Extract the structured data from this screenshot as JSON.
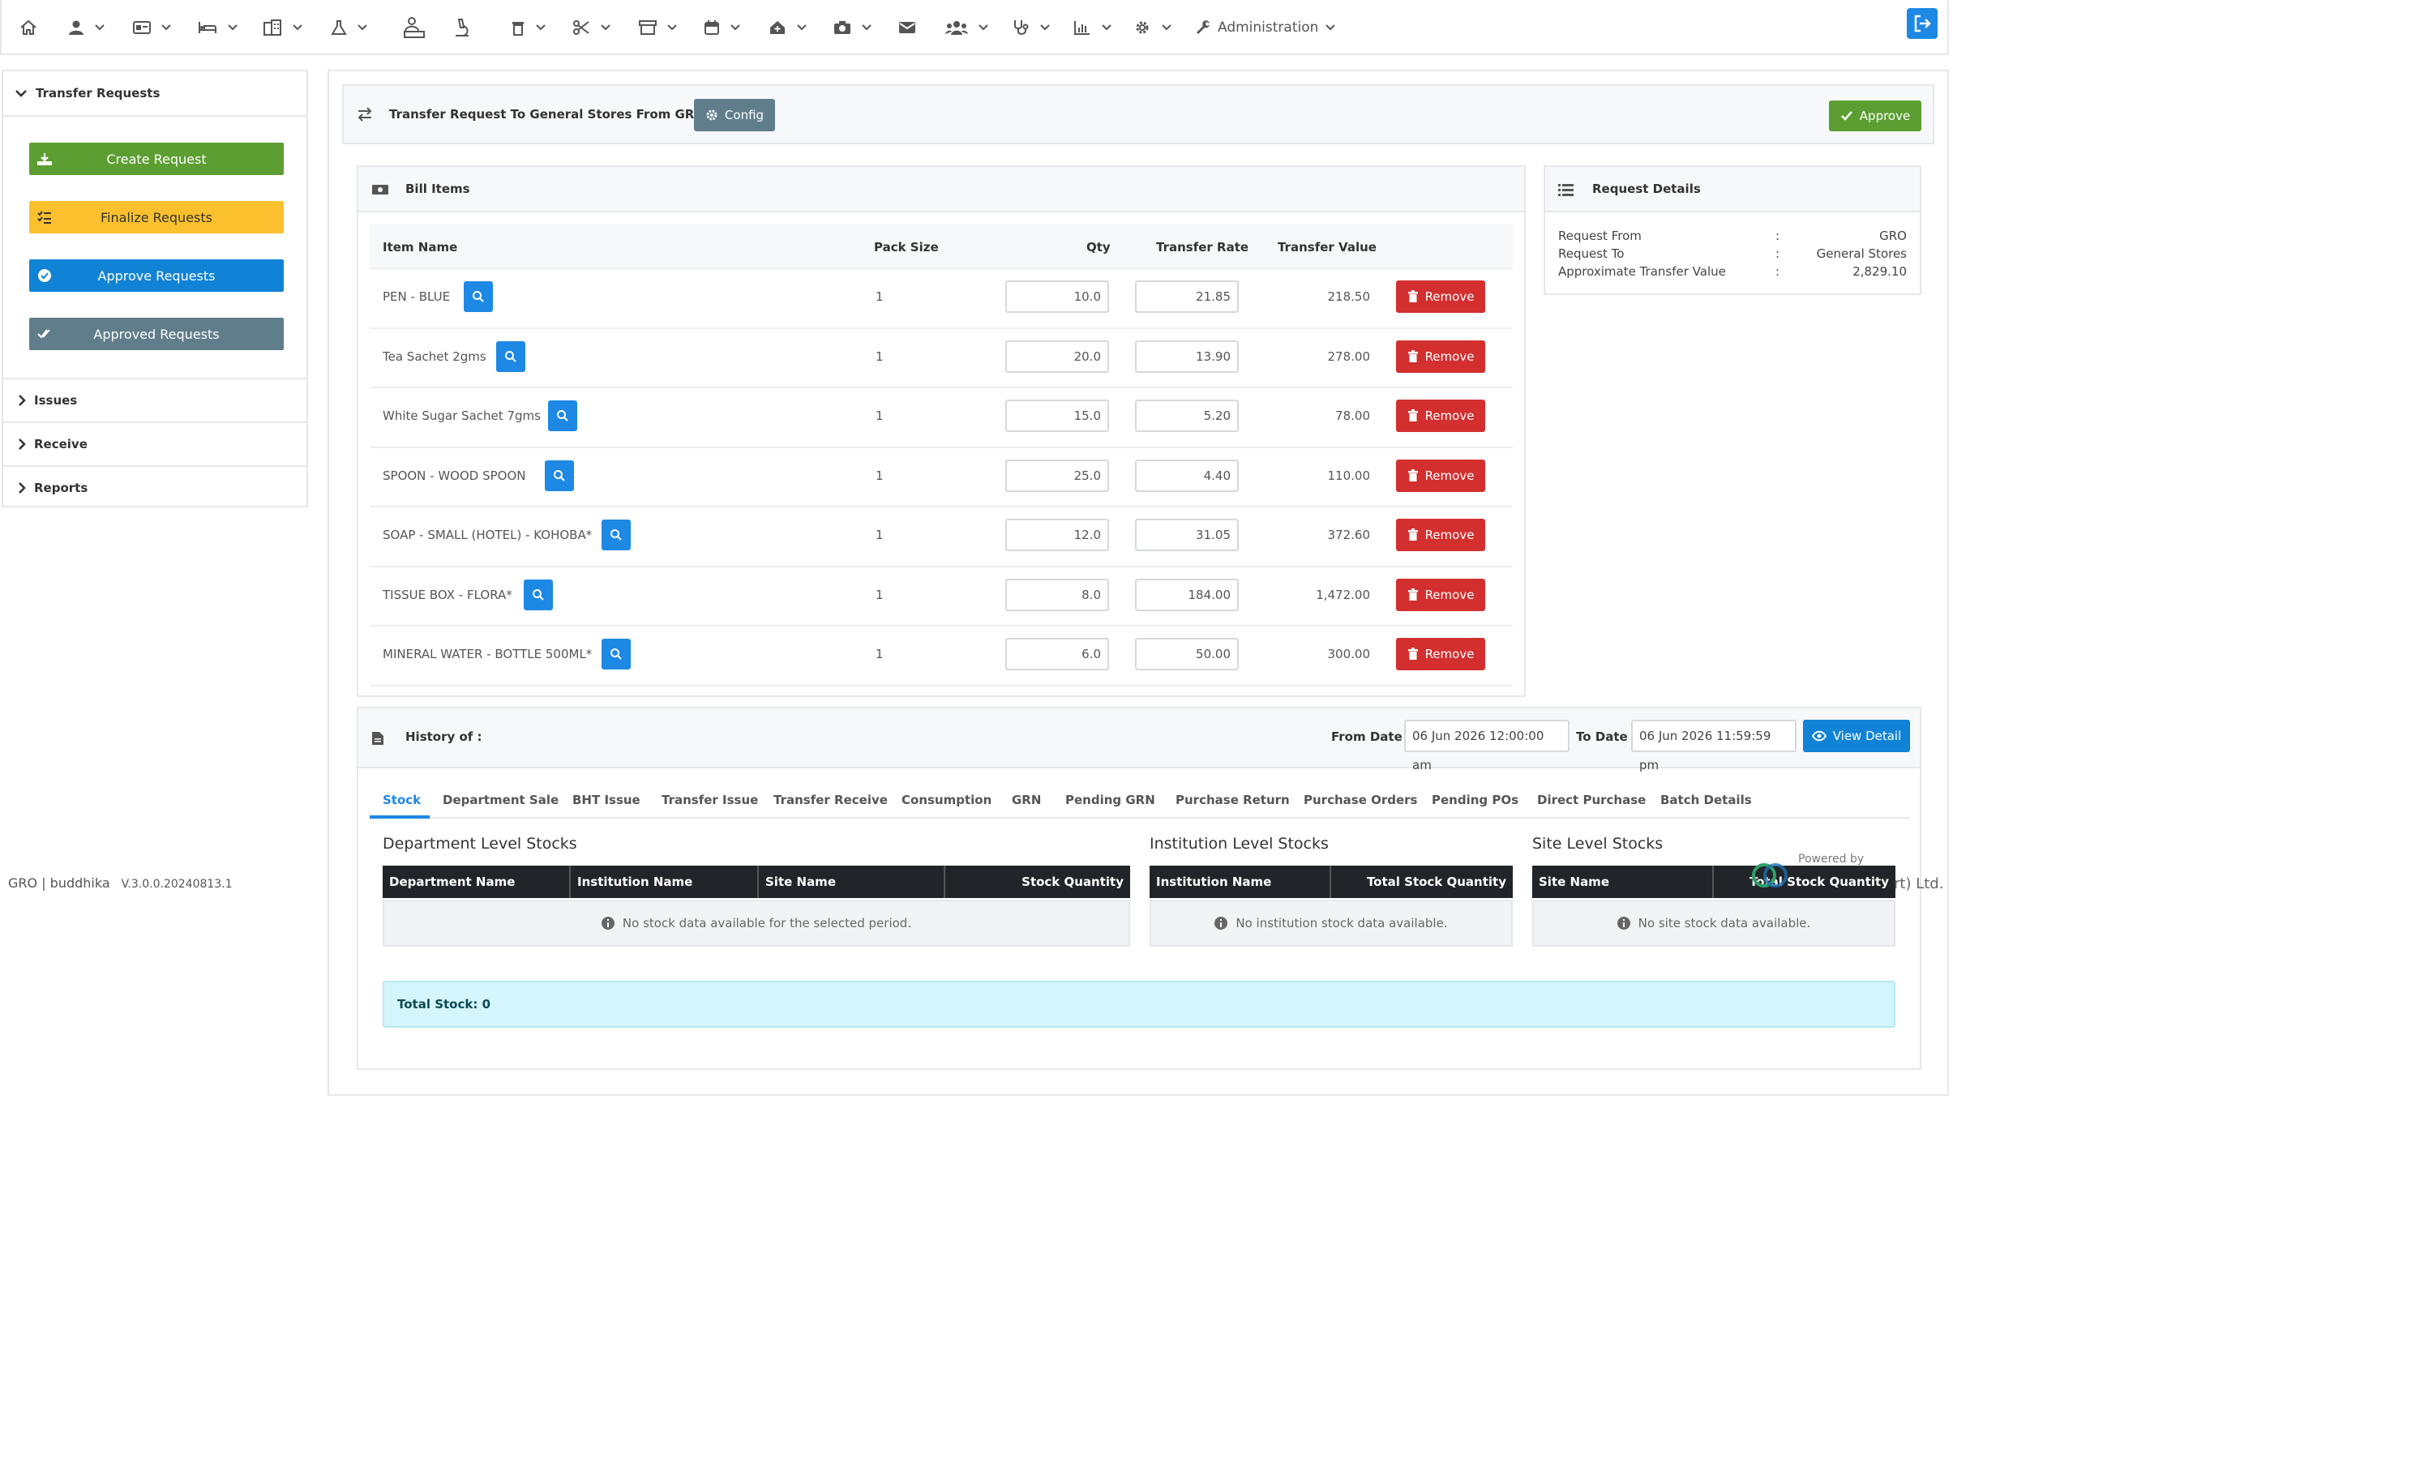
{
  "nav": {
    "icons": [
      "home-icon",
      "user-icon",
      "id-card-icon",
      "bed-icon",
      "building-icon",
      "flask-icon",
      "lab-user-icon",
      "microscope-icon",
      "trash-icon",
      "scissors-icon",
      "box-icon",
      "calendar-icon",
      "house-medical-icon",
      "camera-icon",
      "mail-icon",
      "users-icon",
      "stethoscope-icon",
      "chart-icon",
      "gear-icon",
      "wrench-icon"
    ],
    "admin_label": "Administration"
  },
  "sidebar": {
    "header": "Transfer Requests",
    "buttons": [
      {
        "label": "Create Request",
        "color": "#5c9e31"
      },
      {
        "label": "Finalize Requests",
        "color": "#fbc02d"
      },
      {
        "label": "Approve Requests",
        "color": "#1083d6"
      },
      {
        "label": "Approved Requests",
        "color": "#607d8b"
      }
    ],
    "sections": [
      "Issues",
      "Receive",
      "Reports"
    ]
  },
  "footer": {
    "user": "GRO | buddhika",
    "version": "V.3.0.0.20240813.1",
    "powered_by": "Powered by",
    "company_suffix": "rt) Ltd."
  },
  "header": {
    "title": "Transfer Request To General Stores From GRO",
    "config_label": "Config",
    "approve_label": "Approve"
  },
  "bill": {
    "title": "Bill Items",
    "columns": {
      "item": "Item Name",
      "pack": "Pack Size",
      "qty": "Qty",
      "rate": "Transfer Rate",
      "value": "Transfer Value"
    },
    "remove_label": "Remove",
    "rows": [
      {
        "name": "PEN - BLUE",
        "pack": "1",
        "qty": "10.0",
        "rate": "21.85",
        "value": "218.50"
      },
      {
        "name": "Tea Sachet 2gms",
        "pack": "1",
        "qty": "20.0",
        "rate": "13.90",
        "value": "278.00"
      },
      {
        "name": "White Sugar Sachet 7gms",
        "pack": "1",
        "qty": "15.0",
        "rate": "5.20",
        "value": "78.00"
      },
      {
        "name": "SPOON - WOOD SPOON",
        "pack": "1",
        "qty": "25.0",
        "rate": "4.40",
        "value": "110.00"
      },
      {
        "name": "SOAP - SMALL (HOTEL) - KOHOBA*",
        "pack": "1",
        "qty": "12.0",
        "rate": "31.05",
        "value": "372.60"
      },
      {
        "name": "TISSUE BOX - FLORA*",
        "pack": "1",
        "qty": "8.0",
        "rate": "184.00",
        "value": "1,472.00"
      },
      {
        "name": "MINERAL WATER - BOTTLE 500ML*",
        "pack": "1",
        "qty": "6.0",
        "rate": "50.00",
        "value": "300.00"
      }
    ]
  },
  "request_details": {
    "title": "Request Details",
    "rows": [
      {
        "label": "Request From",
        "sep": ":",
        "value": "GRO"
      },
      {
        "label": "Request To",
        "sep": ":",
        "value": "General Stores"
      },
      {
        "label": "Approximate Transfer Value",
        "sep": ":",
        "value": "2,829.10"
      }
    ]
  },
  "history": {
    "title": "History of :",
    "from_label": "From Date",
    "from_value": "06 Jun 2026 12:00:00 am",
    "to_label": "To Date",
    "to_value": "06 Jun 2026 11:59:59 pm",
    "view_label": "View Detail",
    "tabs": [
      "Stock",
      "Department Sale",
      "BHT Issue",
      "Transfer Issue",
      "Transfer Receive",
      "Consumption",
      "GRN",
      "Pending GRN",
      "Purchase Return",
      "Purchase Orders",
      "Pending POs",
      "Direct Purchase",
      "Batch Details"
    ],
    "active_tab": "Stock",
    "department": {
      "title": "Department Level Stocks",
      "columns": [
        "Department Name",
        "Institution Name",
        "Site Name",
        "Stock Quantity"
      ],
      "empty": "No stock data available for the selected period."
    },
    "institution": {
      "title": "Institution Level Stocks",
      "columns": [
        "Institution Name",
        "Total Stock Quantity"
      ],
      "empty": "No institution stock data available."
    },
    "site": {
      "title": "Site Level Stocks",
      "columns": [
        "Site Name",
        "Total Stock Quantity"
      ],
      "empty": "No site stock data available."
    },
    "total": "Total Stock: 0"
  }
}
